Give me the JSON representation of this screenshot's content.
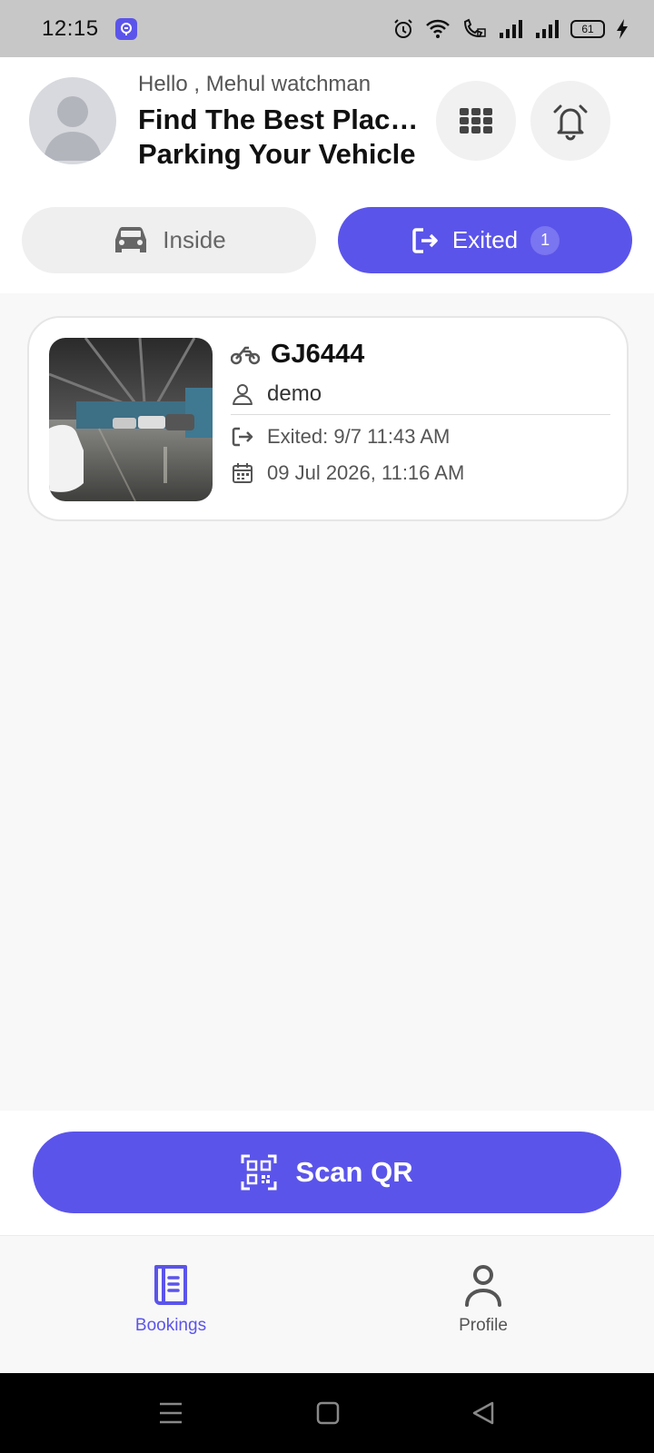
{
  "status_bar": {
    "time": "12:15",
    "battery": "61"
  },
  "header": {
    "greeting": "Hello , Mehul watchman",
    "headline_line1": "Find The Best Place ...",
    "headline_line2": "Parking Your Vehicle"
  },
  "tabs": [
    {
      "label": "Inside",
      "icon": "car-icon",
      "active": false
    },
    {
      "label": "Exited",
      "icon": "exit-icon",
      "active": true,
      "count": "1"
    }
  ],
  "booking": {
    "vehicle_type_icon": "motorcycle-icon",
    "plate": "GJ6444",
    "owner": "demo",
    "exited": "Exited: 9/7 11:43 AM",
    "date": "09 Jul 2026, 11:16 AM"
  },
  "scan_button": {
    "label": "Scan QR"
  },
  "bottom_nav": [
    {
      "label": "Bookings",
      "icon": "bookings-icon",
      "active": true
    },
    {
      "label": "Profile",
      "icon": "profile-icon",
      "active": false
    }
  ],
  "colors": {
    "accent": "#5b54ea",
    "background": "#f8f8f8",
    "inactive_tab": "#efefef"
  }
}
